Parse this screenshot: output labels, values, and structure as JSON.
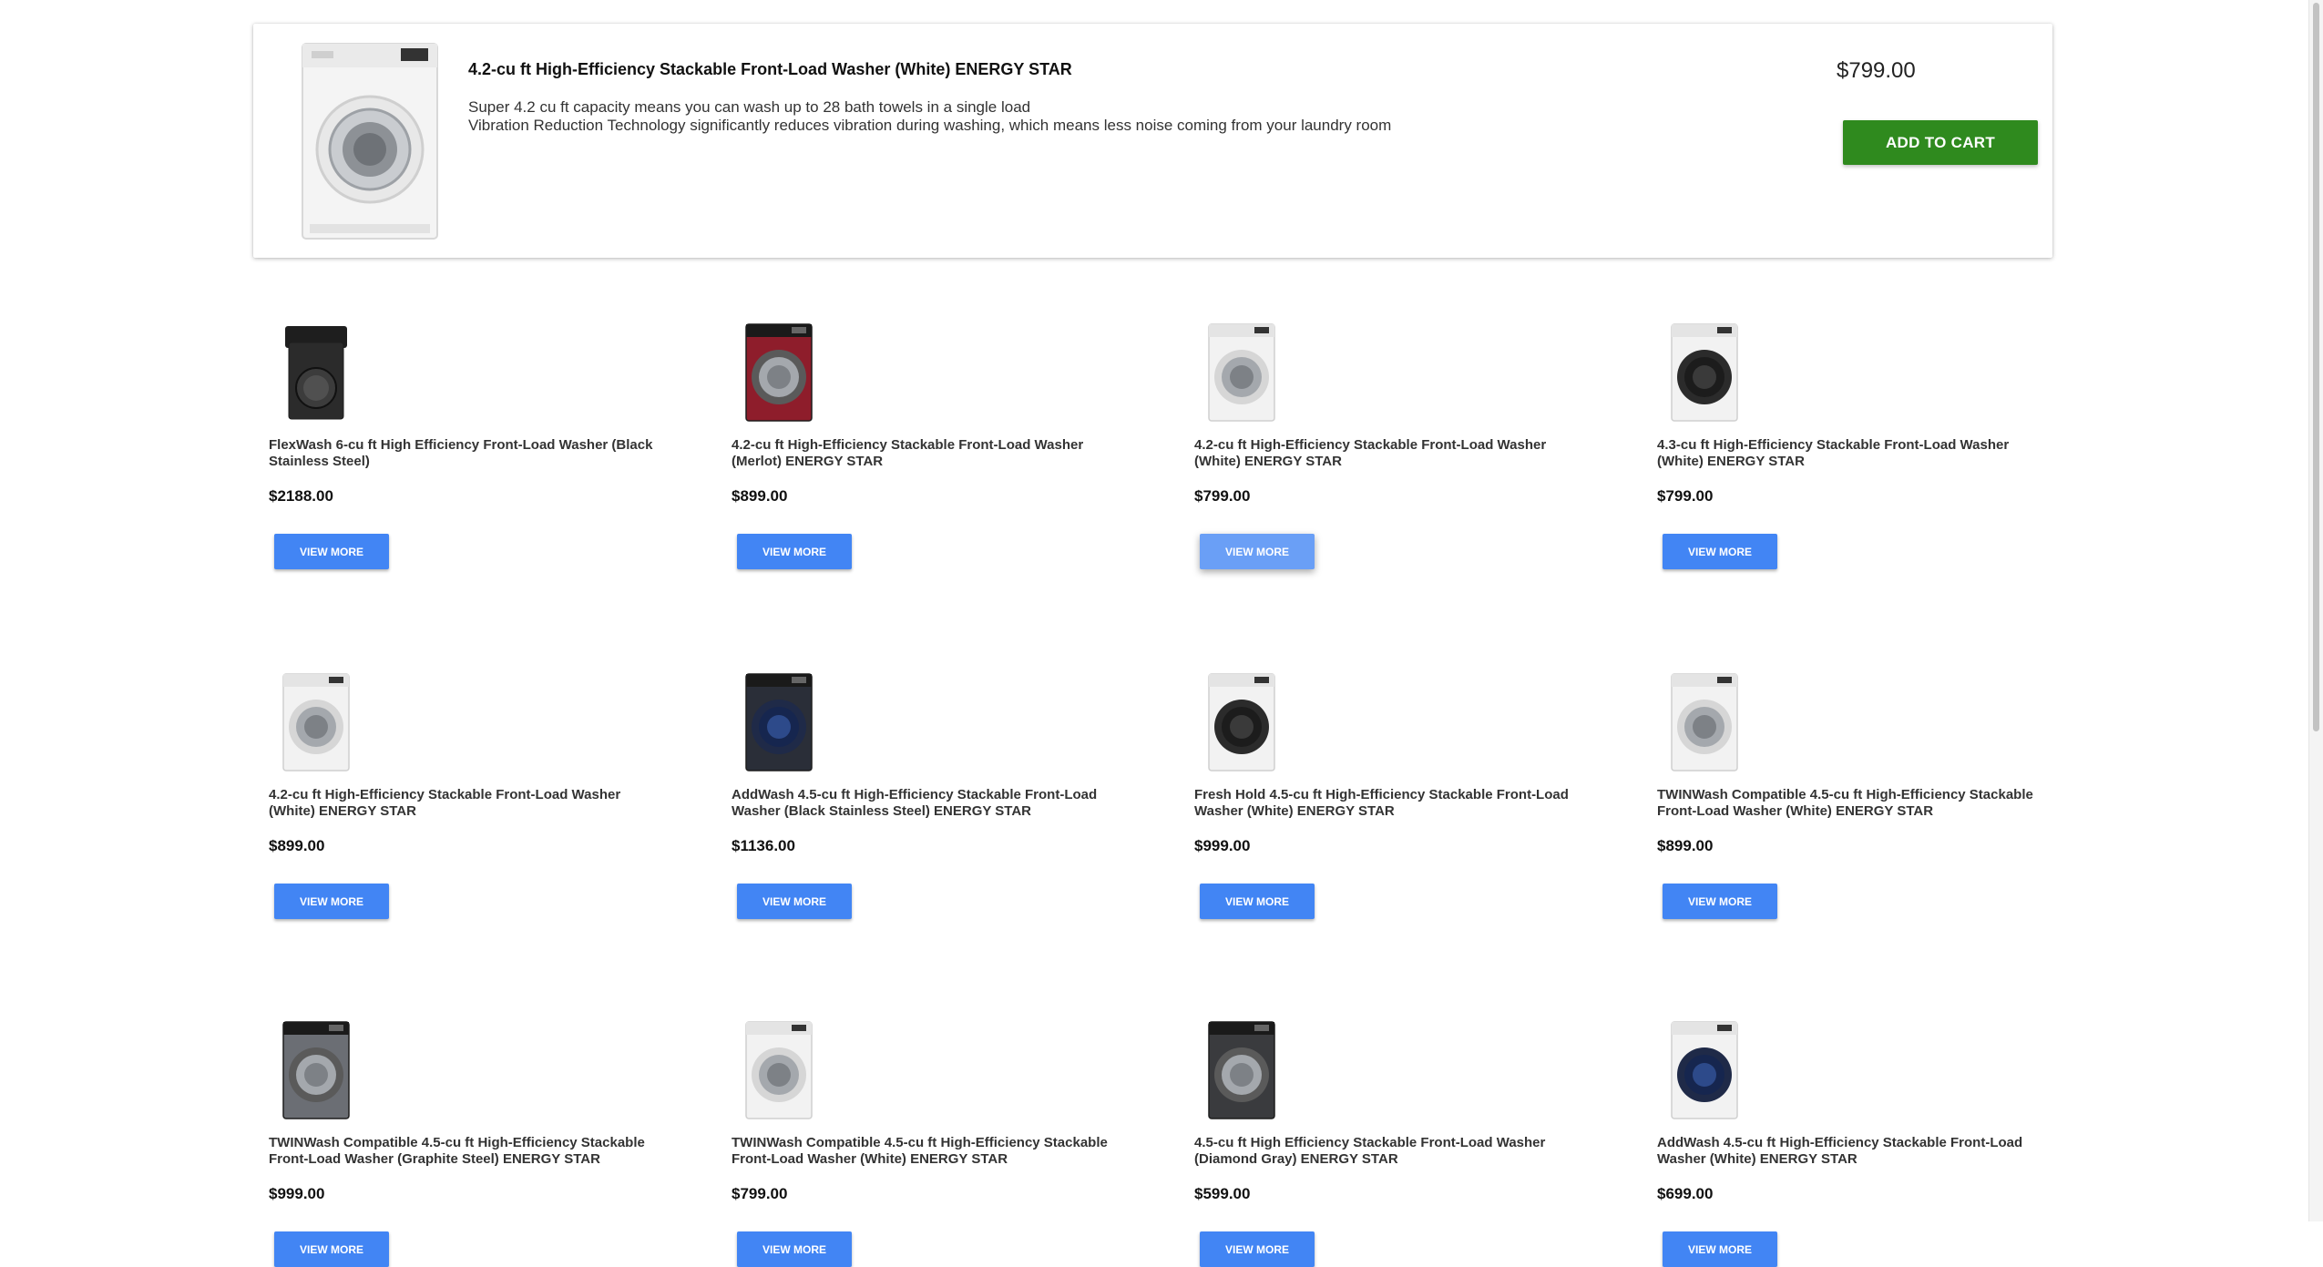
{
  "featured": {
    "title": "4.2-cu ft High-Efficiency Stackable Front-Load Washer (White) ENERGY STAR",
    "description": [
      "Super 4.2 cu ft capacity means you can wash up to 28 bath towels in a single load",
      "Vibration Reduction Technology significantly reduces vibration during washing, which means less noise coming from your laundry room"
    ],
    "price": "$799.00",
    "add_to_cart_label": "ADD TO CART"
  },
  "products": [
    {
      "name": "FlexWash 6-cu ft High Efficiency Front-Load Washer (Black Stainless Steel)",
      "price": "$2188.00",
      "button": "VIEW MORE",
      "color": "#2b2b2b",
      "style": "top-load"
    },
    {
      "name": "4.2-cu ft High-Efficiency Stackable Front-Load Washer (Merlot) ENERGY STAR",
      "price": "$899.00",
      "button": "VIEW MORE",
      "color": "#8e1d2b",
      "style": "front-load"
    },
    {
      "name": "4.2-cu ft High-Efficiency Stackable Front-Load Washer (White) ENERGY STAR",
      "price": "$799.00",
      "button": "VIEW MORE",
      "color": "#f2f2f2",
      "style": "front-load"
    },
    {
      "name": "4.3-cu ft High-Efficiency Stackable Front-Load Washer (White) ENERGY STAR",
      "price": "$799.00",
      "button": "VIEW MORE",
      "color": "#f2f2f2",
      "style": "dark-door"
    },
    {
      "name": "4.2-cu ft High-Efficiency Stackable Front-Load Washer (White) ENERGY STAR",
      "price": "$899.00",
      "button": "VIEW MORE",
      "color": "#f2f2f2",
      "style": "front-load"
    },
    {
      "name": "AddWash 4.5-cu ft High-Efficiency Stackable Front-Load Washer (Black Stainless Steel) ENERGY STAR",
      "price": "$1136.00",
      "button": "VIEW MORE",
      "color": "#2a2e38",
      "style": "blue-door"
    },
    {
      "name": "Fresh Hold 4.5-cu ft High-Efficiency Stackable Front-Load Washer (White) ENERGY STAR",
      "price": "$999.00",
      "button": "VIEW MORE",
      "color": "#f2f2f2",
      "style": "dark-door"
    },
    {
      "name": "TWINWash Compatible 4.5-cu ft High-Efficiency Stackable Front-Load Washer (White) ENERGY STAR",
      "price": "$899.00",
      "button": "VIEW MORE",
      "color": "#f2f2f2",
      "style": "front-load"
    },
    {
      "name": "TWINWash Compatible 4.5-cu ft High-Efficiency Stackable Front-Load Washer (Graphite Steel) ENERGY STAR",
      "price": "$999.00",
      "button": "VIEW MORE",
      "color": "#6b6e74",
      "style": "front-load"
    },
    {
      "name": "TWINWash Compatible 4.5-cu ft High-Efficiency Stackable Front-Load Washer (White) ENERGY STAR",
      "price": "$799.00",
      "button": "VIEW MORE",
      "color": "#f2f2f2",
      "style": "front-load"
    },
    {
      "name": "4.5-cu ft High Efficiency Stackable Front-Load Washer (Diamond Gray) ENERGY STAR",
      "price": "$599.00",
      "button": "VIEW MORE",
      "color": "#3a3b3e",
      "style": "front-load"
    },
    {
      "name": "AddWash 4.5-cu ft High-Efficiency Stackable Front-Load Washer (White) ENERGY STAR",
      "price": "$699.00",
      "button": "VIEW MORE",
      "color": "#f2f2f2",
      "style": "blue-door"
    }
  ],
  "colors": {
    "add_to_cart": "#2f8a1e",
    "view_more": "#4285f4",
    "view_more_hover": "#6a9ff6"
  }
}
